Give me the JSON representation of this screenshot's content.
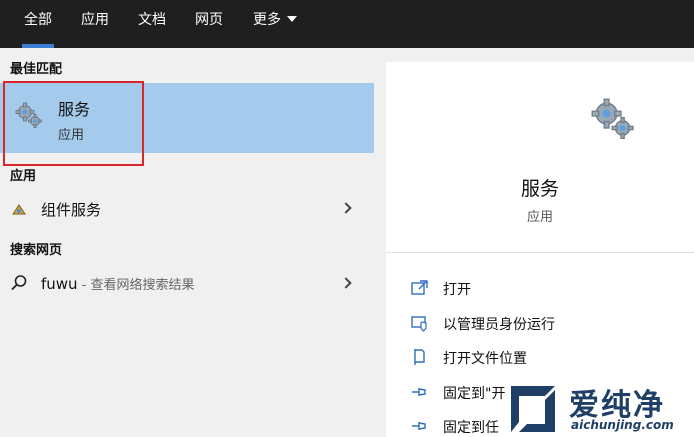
{
  "tabs": [
    {
      "label": "全部",
      "active": true
    },
    {
      "label": "应用"
    },
    {
      "label": "文档"
    },
    {
      "label": "网页"
    },
    {
      "label": "更多"
    }
  ],
  "sections": {
    "best_match": "最佳匹配",
    "apps": "应用",
    "web": "搜索网页"
  },
  "best_match_item": {
    "title": "服务",
    "subtitle": "应用",
    "icon": "gears-icon"
  },
  "app_item": {
    "label": "组件服务",
    "icon": "component-services-icon"
  },
  "web_item": {
    "query": "fuwu",
    "hint": " - 查看网络搜索结果",
    "icon": "search-icon"
  },
  "detail": {
    "title": "服务",
    "type": "应用",
    "icon": "gears-icon"
  },
  "actions": [
    {
      "label": "打开",
      "icon": "open-icon"
    },
    {
      "label": "以管理员身份运行",
      "icon": "admin-shield-icon"
    },
    {
      "label": "打开文件位置",
      "icon": "file-location-icon"
    },
    {
      "label": "固定到\"开",
      "icon": "pin-icon"
    },
    {
      "label": "固定到任",
      "icon": "pin-icon"
    }
  ],
  "watermark": {
    "brand": "爱纯净",
    "domain": "aichunjing.com"
  },
  "colors": {
    "accent": "#3a7ed4",
    "selected": "#a5cbec",
    "highlight_box": "#d9262a",
    "topbar": "#1f1f1f"
  }
}
